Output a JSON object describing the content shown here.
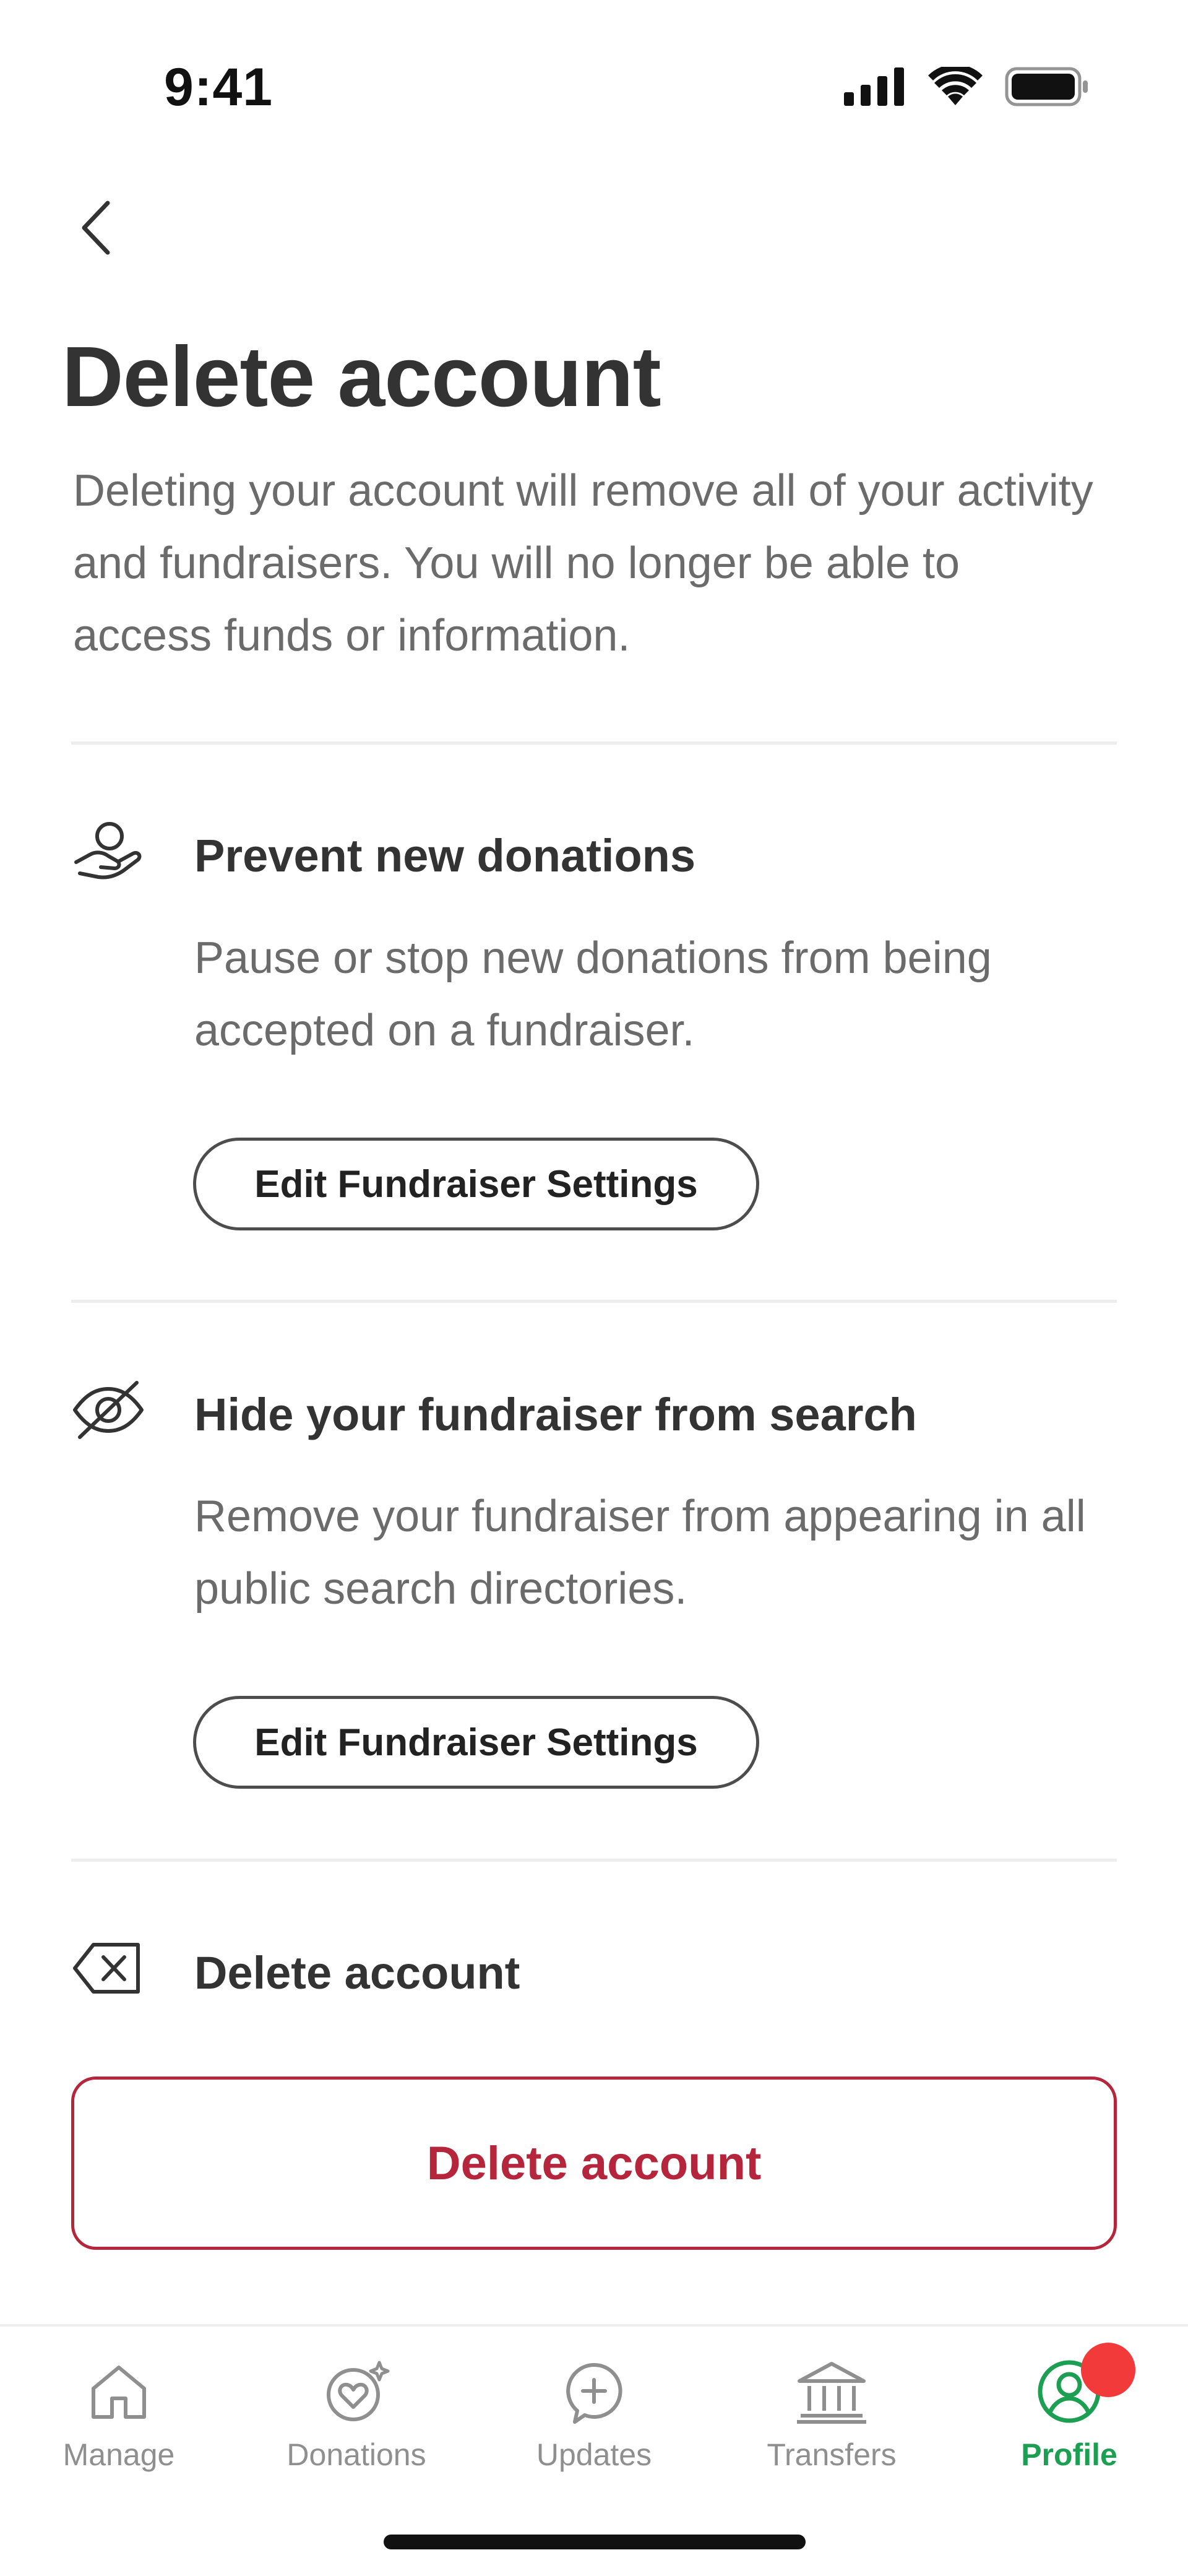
{
  "status_bar": {
    "time": "9:41",
    "icons": [
      "cellular-signal-icon",
      "wifi-icon",
      "battery-icon"
    ]
  },
  "header": {
    "back_icon": "chevron-left-icon",
    "title": "Delete account",
    "description": "Deleting your account will remove all of your activity and fundraisers. You will no longer be able to access funds or information."
  },
  "sections": [
    {
      "icon": "hand-coin-icon",
      "title": "Prevent new donations",
      "description": "Pause or stop new donations from being accepted on a fundraiser.",
      "button_label": "Edit Fundraiser Settings"
    },
    {
      "icon": "eye-off-icon",
      "title": "Hide your fundraiser from search",
      "description": "Remove your fundraiser from appearing in all public search directories.",
      "button_label": "Edit Fundraiser Settings"
    },
    {
      "icon": "backspace-delete-icon",
      "title": "Delete account",
      "button_label": "Delete account"
    }
  ],
  "tab_bar": {
    "items": [
      {
        "label": "Manage",
        "icon": "home-icon",
        "active": false
      },
      {
        "label": "Donations",
        "icon": "heart-sparkle-icon",
        "active": false
      },
      {
        "label": "Updates",
        "icon": "plus-bubble-icon",
        "active": false
      },
      {
        "label": "Transfers",
        "icon": "bank-icon",
        "active": false
      },
      {
        "label": "Profile",
        "icon": "user-circle-icon",
        "active": true,
        "has_notification": true
      }
    ]
  },
  "colors": {
    "text_primary": "#333333",
    "text_secondary": "#6b6b6b",
    "danger": "#b5253c",
    "active_tab": "#1c9e53",
    "inactive_tab": "#8f8f8f",
    "notification": "#f23a3a"
  }
}
